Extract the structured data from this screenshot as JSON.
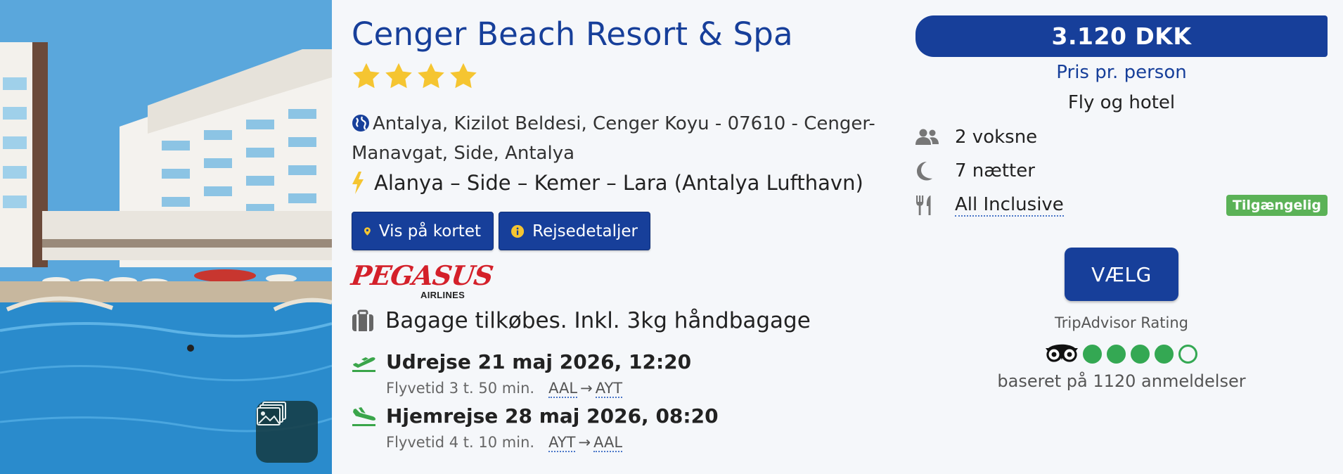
{
  "hotel": {
    "name": "Cenger Beach Resort & Spa",
    "stars": 4,
    "address": "Antalya, Kizilot Beldesi, Cenger Koyu - 07610 - Cenger-Manavgat, Side, Antalya",
    "airport": "Alanya – Side – Kemer – Lara (Antalya Lufthavn)"
  },
  "buttons": {
    "map": "Vis på kortet",
    "travel_details": "Rejsedetaljer",
    "select": "VÆLG"
  },
  "airline": {
    "name": "PEGASUS",
    "sub": "AIRLINES"
  },
  "luggage": "Bagage tilkøbes. Inkl. 3kg håndbagage",
  "flights": {
    "outbound": {
      "title": "Udrejse 21 maj 2026, 12:20",
      "duration": "Flyvetid 3 t. 50 min.",
      "from": "AAL",
      "arrow": "→",
      "to": "AYT"
    },
    "return": {
      "title": "Hjemrejse 28 maj 2026, 08:20",
      "duration": "Flyvetid 4 t. 10 min.",
      "from": "AYT",
      "arrow": "→",
      "to": "AAL"
    }
  },
  "price": {
    "amount": "3.120 DKK",
    "per_person": "Pris pr. person",
    "package": "Fly og hotel"
  },
  "details": {
    "adults": "2 voksne",
    "nights": "7 nætter",
    "board": "All Inclusive",
    "availability": "Tilgængelig"
  },
  "tripadvisor": {
    "label": "TripAdvisor Rating",
    "rating": 4,
    "max": 5,
    "reviews": "baseret på 1120 anmeldelser"
  },
  "colors": {
    "brand": "#173f9a",
    "star": "#f5c531",
    "available": "#5bb257",
    "tripadvisor": "#34a853"
  },
  "icons": {
    "gallery": "gallery-icon",
    "globe": "globe-icon",
    "bolt": "bolt-icon",
    "map_pin": "map-pin-icon",
    "info": "info-icon",
    "luggage": "luggage-icon",
    "takeoff": "plane-takeoff-icon",
    "landing": "plane-landing-icon",
    "users": "users-icon",
    "moon": "moon-icon",
    "cutlery": "cutlery-icon",
    "owl": "tripadvisor-owl-icon"
  }
}
